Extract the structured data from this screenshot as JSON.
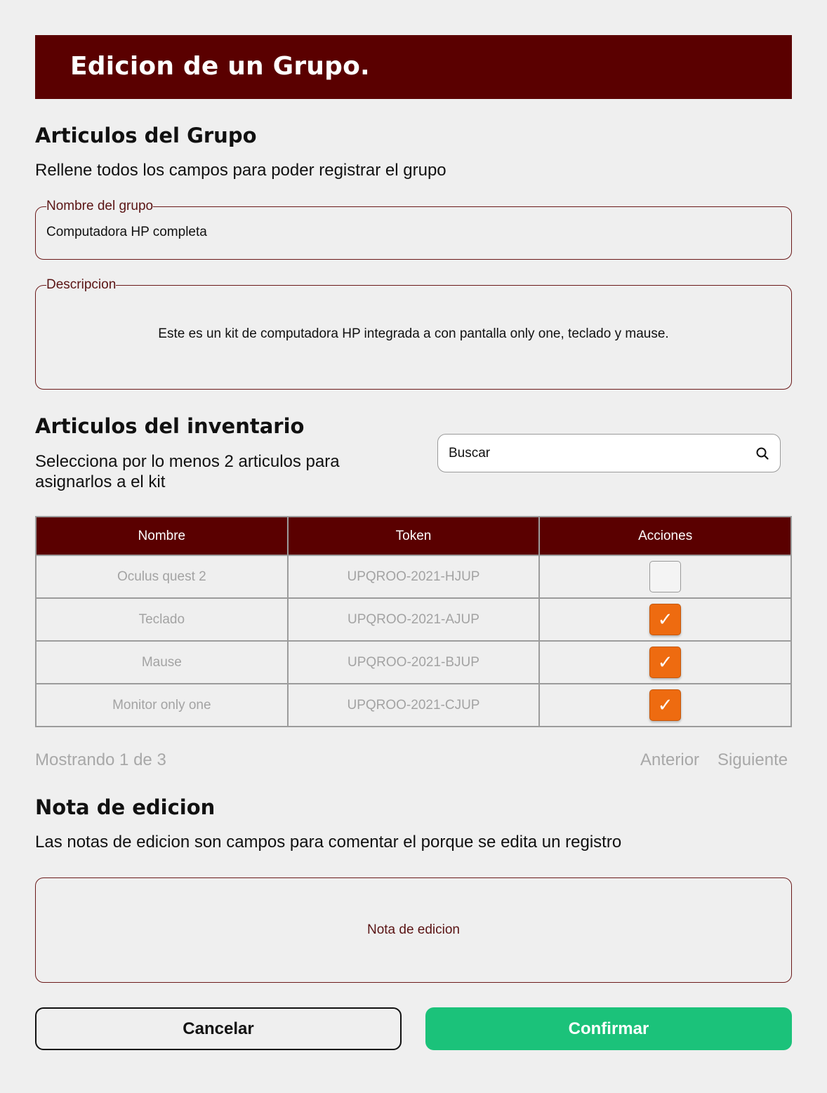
{
  "header": {
    "title": "Edicion de un Grupo."
  },
  "group_section": {
    "title": "Articulos del Grupo",
    "subtitle": "Rellene todos los campos para poder registrar el grupo"
  },
  "fields": {
    "name": {
      "label": "Nombre del grupo",
      "value": "Computadora HP completa"
    },
    "description": {
      "label": "Descripcion",
      "value": "Este es un kit de computadora HP integrada a con pantalla only one, teclado y mause."
    }
  },
  "inventory": {
    "title": "Articulos del inventario",
    "subtitle_line1": "Selecciona por lo menos 2 articulos para",
    "subtitle_line2": "asignarlos a el kit",
    "search": {
      "placeholder": "Buscar",
      "icon": "search-icon"
    },
    "columns": [
      "Nombre",
      "Token",
      "Acciones"
    ],
    "rows": [
      {
        "name": "Oculus quest 2",
        "token": "UPQROO-2021-HJUP",
        "checked": false
      },
      {
        "name": "Teclado",
        "token": "UPQROO-2021-AJUP",
        "checked": true
      },
      {
        "name": "Mause",
        "token": "UPQROO-2021-BJUP",
        "checked": true
      },
      {
        "name": "Monitor only one",
        "token": "UPQROO-2021-CJUP",
        "checked": true
      }
    ],
    "check_glyph": "✓"
  },
  "pagination": {
    "info": "Mostrando 1 de 3",
    "prev": "Anterior",
    "next": "Siguiente"
  },
  "edit_note": {
    "title": "Nota de edicion",
    "subtitle": "Las notas de edicion son campos para comentar el porque se edita un registro",
    "placeholder": "Nota de edicion"
  },
  "actions": {
    "cancel": "Cancelar",
    "confirm": "Confirmar"
  },
  "colors": {
    "brand": "#5a0000",
    "checkbox_on": "#ee6b10",
    "confirm": "#1bc27a",
    "background": "#efefef"
  }
}
